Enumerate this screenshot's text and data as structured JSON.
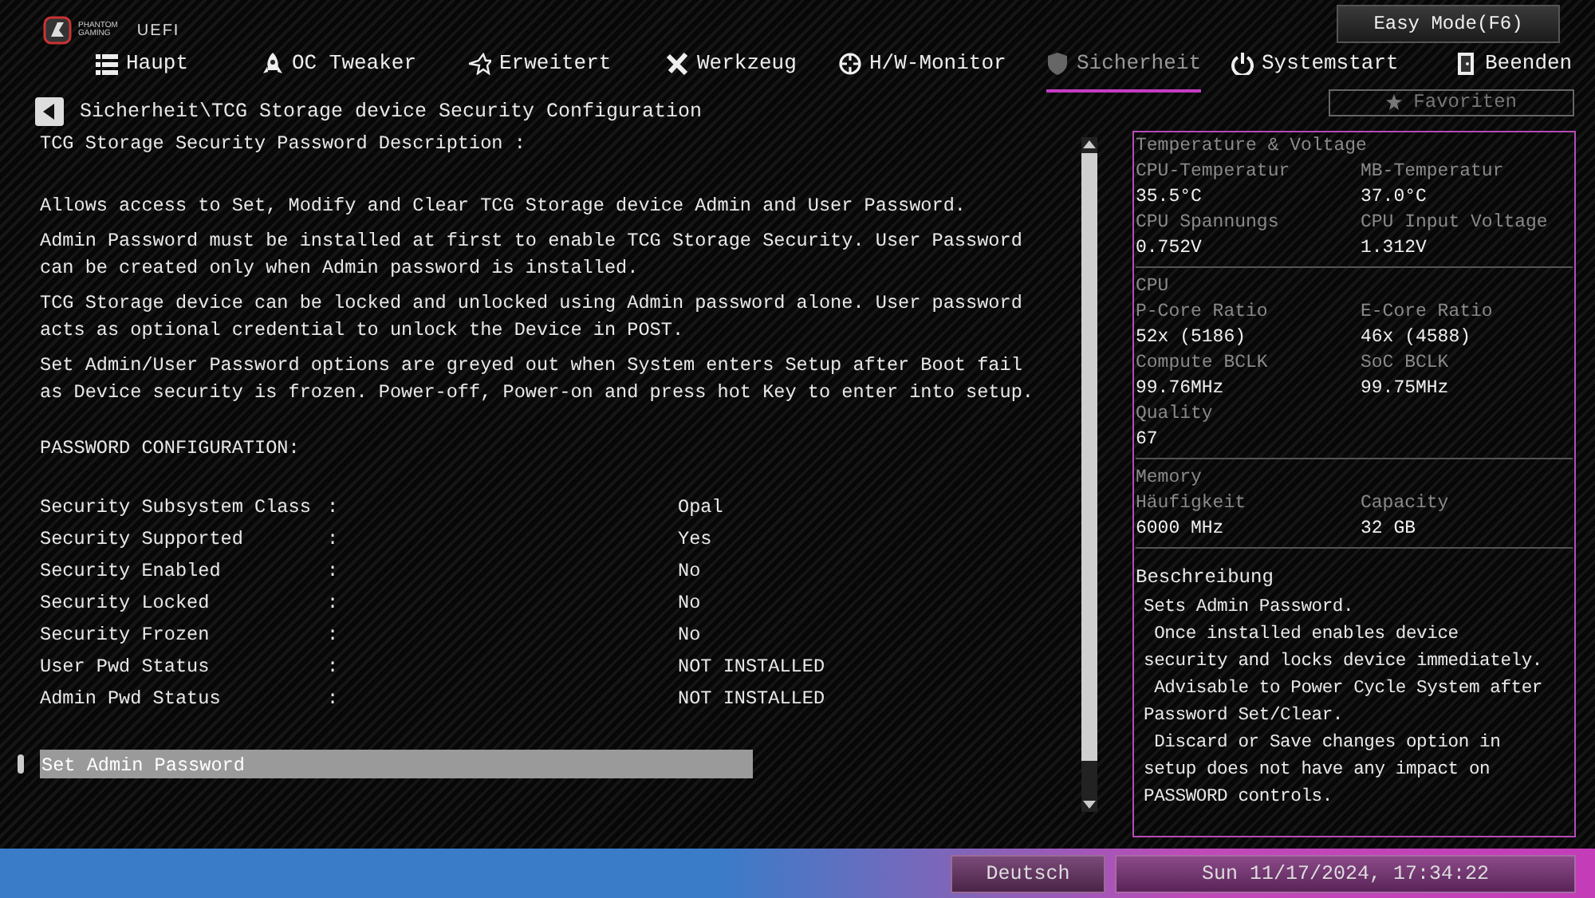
{
  "header": {
    "logo_lines": [
      "PHANTOM",
      "GAMING"
    ],
    "logo_suffix": "UEFI",
    "easy_mode_button": "Easy Mode(F6)"
  },
  "tabs": [
    {
      "label": "Haupt",
      "selected": false
    },
    {
      "label": "OC Tweaker",
      "selected": false
    },
    {
      "label": "Erweitert",
      "selected": false
    },
    {
      "label": "Werkzeug",
      "selected": false
    },
    {
      "label": "H/W-Monitor",
      "selected": false
    },
    {
      "label": "Sicherheit",
      "selected": true
    },
    {
      "label": "Systemstart",
      "selected": false
    },
    {
      "label": "Beenden",
      "selected": false
    }
  ],
  "breadcrumb": "Sicherheit\\TCG Storage device Security Configuration",
  "favorites_button": "Favoriten",
  "content": {
    "title": "TCG Storage Security Password Description :",
    "paragraphs": [
      "Allows access to Set, Modify and Clear TCG Storage device Admin and User Password.",
      "Admin Password must be installed at first to enable TCG Storage Security. User Password can be created only when Admin password is installed.",
      "TCG Storage device can be locked and unlocked using Admin password alone. User password acts as optional credential to unlock the Device in POST.",
      "Set Admin/User Password options are greyed out when System enters Setup after Boot fail as Device security is frozen. Power-off, Power-on and press hot Key to enter into setup."
    ],
    "section_heading": "PASSWORD CONFIGURATION:",
    "rows": [
      {
        "label": "Security Subsystem Class",
        "separator": ":",
        "value": "Opal"
      },
      {
        "label": "Security Supported",
        "separator": ":",
        "value": "Yes"
      },
      {
        "label": "Security Enabled",
        "separator": ":",
        "value": "No"
      },
      {
        "label": "Security Locked",
        "separator": ":",
        "value": "No"
      },
      {
        "label": "Security Frozen",
        "separator": ":",
        "value": "No"
      },
      {
        "label": "User Pwd Status",
        "separator": ":",
        "value": "NOT INSTALLED"
      },
      {
        "label": "Admin Pwd Status",
        "separator": ":",
        "value": "NOT INSTALLED"
      }
    ],
    "menu_items": [
      {
        "label": "Set Admin Password",
        "selected": true
      }
    ]
  },
  "monitor": {
    "sections": [
      {
        "title": "Temperature & Voltage",
        "items": [
          {
            "label": "CPU-Temperatur",
            "value": "35.5°C"
          },
          {
            "label": "MB-Temperatur",
            "value": "37.0°C"
          },
          {
            "label": "CPU Spannungs",
            "value": "0.752V"
          },
          {
            "label": "CPU Input Voltage",
            "value": "1.312V"
          }
        ]
      },
      {
        "title": "CPU",
        "items": [
          {
            "label": "P-Core Ratio",
            "value": "52x (5186)"
          },
          {
            "label": "E-Core Ratio",
            "value": "46x (4588)"
          },
          {
            "label": "Compute BCLK",
            "value": "99.76MHz"
          },
          {
            "label": "SoC BCLK",
            "value": "99.75MHz"
          },
          {
            "label": "Quality",
            "value": "67"
          }
        ]
      },
      {
        "title": "Memory",
        "items": [
          {
            "label": "Häufigkeit",
            "value": "6000 MHz"
          },
          {
            "label": "Capacity",
            "value": "32 GB"
          }
        ]
      }
    ],
    "description": {
      "title": "Beschreibung",
      "lines": [
        "Sets Admin Password.",
        " Once installed enables device",
        "security and locks device immediately.",
        " Advisable to Power Cycle System after",
        "Password Set/Clear.",
        " Discard or Save changes option in",
        "setup does not have any impact on",
        "PASSWORD controls."
      ]
    }
  },
  "footer": {
    "language_button": "Deutsch",
    "datetime": "Sun 11/17/2024, 17:34:22"
  }
}
